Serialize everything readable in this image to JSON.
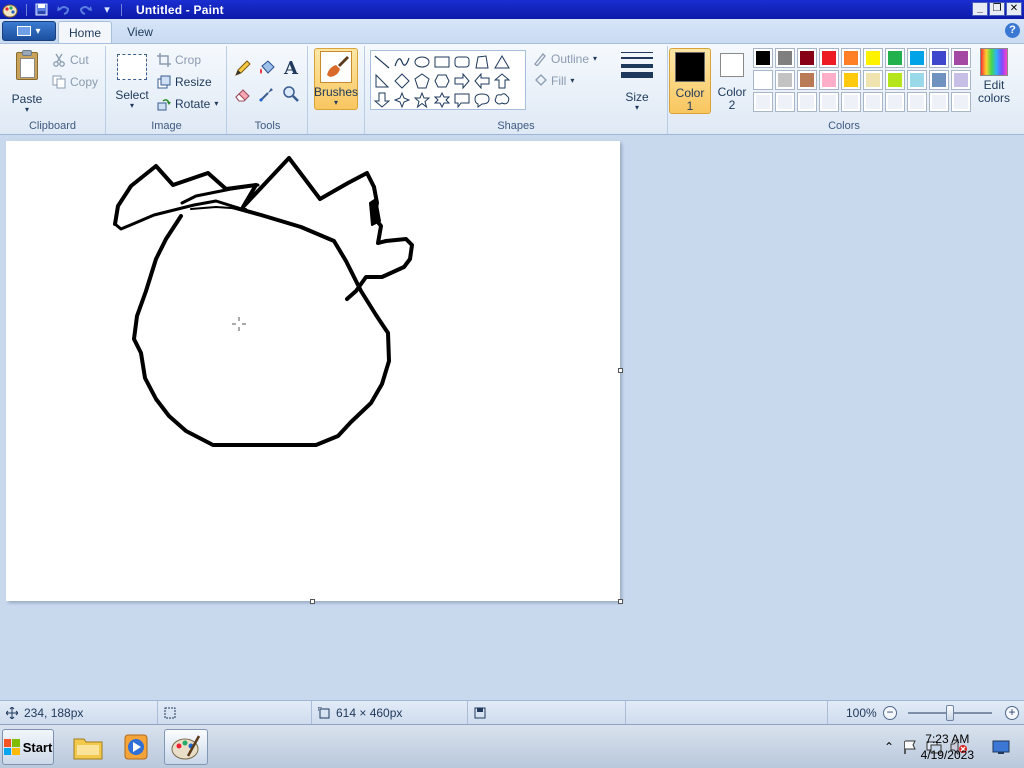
{
  "window": {
    "title": "Untitled - Paint",
    "controls": [
      "minimize",
      "restore",
      "close"
    ]
  },
  "quick_access": [
    "paint-app-icon",
    "save-icon",
    "undo-icon",
    "redo-icon",
    "customize-dropdown-icon"
  ],
  "tabs": [
    {
      "label": "Home",
      "active": true
    },
    {
      "label": "View",
      "active": false
    }
  ],
  "ribbon": {
    "clipboard": {
      "group_label": "Clipboard",
      "paste_label": "Paste",
      "cut_label": "Cut",
      "copy_label": "Copy"
    },
    "image": {
      "group_label": "Image",
      "select_label": "Select",
      "crop_label": "Crop",
      "resize_label": "Resize",
      "rotate_label": "Rotate"
    },
    "tools": {
      "group_label": "Tools",
      "items": [
        "pencil-icon",
        "fill-icon",
        "text-icon",
        "eraser-icon",
        "color-picker-icon",
        "magnifier-icon"
      ]
    },
    "brushes": {
      "label": "Brushes"
    },
    "shapes": {
      "group_label": "Shapes",
      "outline_label": "Outline",
      "fill_label": "Fill"
    },
    "size": {
      "label": "Size"
    },
    "colors": {
      "group_label": "Colors",
      "color1_label_line1": "Color",
      "color1_label_line2": "1",
      "color2_label_line1": "Color",
      "color2_label_line2": "2",
      "edit_label_line1": "Edit",
      "edit_label_line2": "colors",
      "color1": "#000000",
      "color2": "#ffffff",
      "palette_row1": [
        "#000000",
        "#7f7f7f",
        "#880015",
        "#ed1c24",
        "#ff7f27",
        "#fff200",
        "#22b14c",
        "#00a2e8",
        "#3f48cc",
        "#a349a4"
      ],
      "palette_row2": [
        "#ffffff",
        "#c3c3c3",
        "#b97a57",
        "#ffaec9",
        "#ffc90e",
        "#efe4b0",
        "#b5e61d",
        "#99d9ea",
        "#7092be",
        "#c8bfe7"
      ],
      "palette_row3": [
        "",
        "",
        "",
        "",
        "",
        "",
        "",
        "",
        "",
        ""
      ]
    }
  },
  "status": {
    "cursor_pos": "234, 188px",
    "selection_size": "",
    "canvas_size": "614 × 460px",
    "zoom": "100%",
    "zoom_fraction": 0.5
  },
  "taskbar": {
    "start_label": "Start",
    "time": "7:23 AM",
    "date": "4/19/2023",
    "pinned": [
      "file-explorer-icon",
      "media-player-icon",
      "paint-icon"
    ]
  }
}
